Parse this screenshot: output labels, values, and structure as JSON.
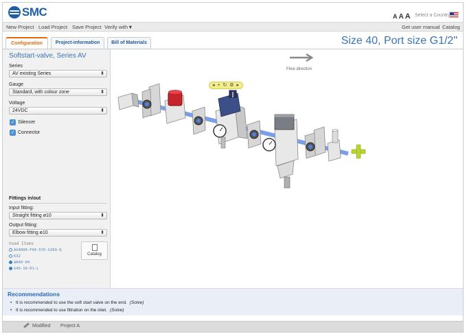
{
  "brand": {
    "logo_text": "SMC"
  },
  "header": {
    "font_size_controls": [
      "A",
      "A",
      "A"
    ],
    "country_label": "Select a Country"
  },
  "menu": {
    "left": [
      "New Project",
      "Load Project",
      "Save Project",
      "Verify with▼"
    ],
    "right": [
      "Get user manual",
      "Catalog"
    ]
  },
  "tabs": [
    {
      "label": "Configuration",
      "active": true
    },
    {
      "label": "Project-information",
      "active": false
    },
    {
      "label": "Bill of Materials",
      "active": false
    }
  ],
  "size_title": "Size 40, Port size G1/2\"",
  "config": {
    "product_title": "Softstart-valve, Series AV",
    "series": {
      "label": "Series",
      "value": "AV existing Series"
    },
    "gauge": {
      "label": "Gauge",
      "value": "Standard, with colour zone"
    },
    "voltage": {
      "label": "Voltage",
      "value": "24VDC"
    },
    "silencer": {
      "label": "Silencer",
      "checked": true
    },
    "connector": {
      "label": "Connector",
      "checked": true
    },
    "fittings_heading": "Fittings in/out",
    "input_fitting": {
      "label": "Input fitting:",
      "value": "Straight fitting ø10"
    },
    "output_fitting": {
      "label": "Output fitting:",
      "value": "Elbow fitting ø10"
    },
    "used_items_heading": "Used Items",
    "used_items": [
      {
        "code": "AV4000-F04-5YO-X260-Q",
        "marker": "outline"
      },
      {
        "code": "K32",
        "marker": "outline"
      },
      {
        "code": "AN40-04",
        "marker": "filled"
      },
      {
        "code": "G46-10-01-L",
        "marker": "filled"
      }
    ],
    "catalog_button": "Catalog"
  },
  "canvas": {
    "flow_direction_label": "Flow direction",
    "toolbar_glyphs": "◂ + ↻ ⚙ ▸"
  },
  "recommendations": {
    "heading": "Recommendations",
    "items": [
      {
        "text": "It is recommended to use the soft start valve on the end.",
        "action": "(Solve)"
      },
      {
        "text": "It is recommended to use filtration on the inlet.",
        "action": "(Solve)"
      }
    ]
  },
  "status": {
    "modified": "Modified",
    "project": "Project A"
  },
  "colors": {
    "brand_blue": "#1f5ea8",
    "accent_orange": "#e06b10",
    "title_blue": "#3b73b5",
    "add_green": "#b8d432",
    "toolbar_yellow": "#f2ec8a"
  }
}
